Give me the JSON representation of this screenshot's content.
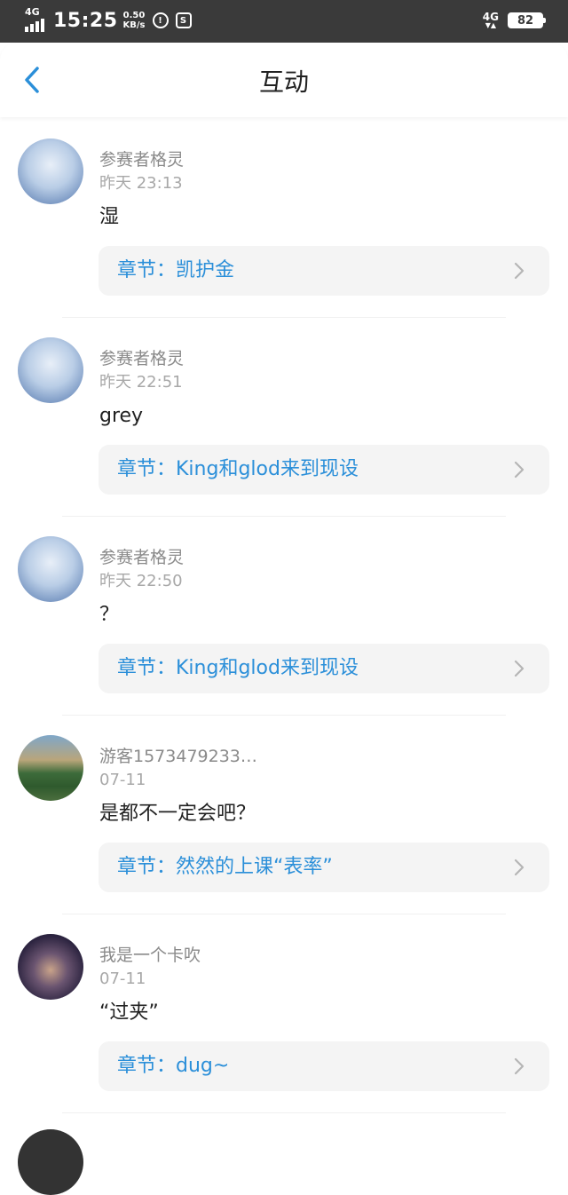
{
  "status_bar": {
    "network_left": "4G",
    "time": "15:25",
    "speed_value": "0.50",
    "speed_unit": "KB/s",
    "network_right": "4G",
    "battery": "82"
  },
  "header": {
    "title": "互动"
  },
  "items": [
    {
      "name": "参赛者格灵",
      "time": "昨天 23:13",
      "content": "湿",
      "chapter": "章节：凯护金",
      "avatar": "anime-girl"
    },
    {
      "name": "参赛者格灵",
      "time": "昨天 22:51",
      "content": "grey",
      "chapter": "章节：King和glod来到现设",
      "avatar": "anime-girl"
    },
    {
      "name": "参赛者格灵",
      "time": "昨天 22:50",
      "content": "？",
      "chapter": "章节：King和glod来到现设",
      "avatar": "anime-girl"
    },
    {
      "name": "游客1573479233…",
      "time": "07-11",
      "content": "是都不一定会吧？",
      "chapter": "章节：然然的上课“表率”",
      "avatar": "landscape"
    },
    {
      "name": "我是一个卡吹",
      "time": "07-11",
      "content": "“过夹”",
      "chapter": "章节：dug~",
      "avatar": "dark-character"
    }
  ],
  "colors": {
    "accent": "#2b8fd9",
    "status_bar": "#3a3a3a",
    "chapter_bg": "#f4f4f4"
  }
}
